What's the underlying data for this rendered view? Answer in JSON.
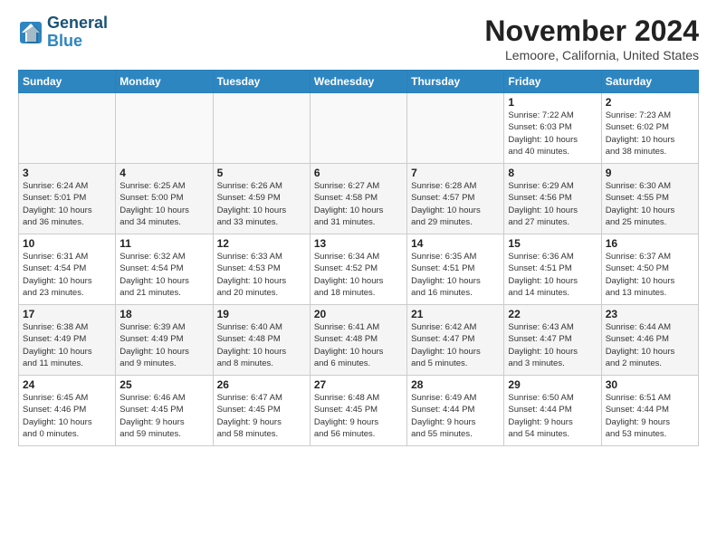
{
  "header": {
    "logo_line1": "General",
    "logo_line2": "Blue",
    "month": "November 2024",
    "location": "Lemoore, California, United States"
  },
  "weekdays": [
    "Sunday",
    "Monday",
    "Tuesday",
    "Wednesday",
    "Thursday",
    "Friday",
    "Saturday"
  ],
  "weeks": [
    [
      {
        "day": "",
        "info": ""
      },
      {
        "day": "",
        "info": ""
      },
      {
        "day": "",
        "info": ""
      },
      {
        "day": "",
        "info": ""
      },
      {
        "day": "",
        "info": ""
      },
      {
        "day": "1",
        "info": "Sunrise: 7:22 AM\nSunset: 6:03 PM\nDaylight: 10 hours\nand 40 minutes."
      },
      {
        "day": "2",
        "info": "Sunrise: 7:23 AM\nSunset: 6:02 PM\nDaylight: 10 hours\nand 38 minutes."
      }
    ],
    [
      {
        "day": "3",
        "info": "Sunrise: 6:24 AM\nSunset: 5:01 PM\nDaylight: 10 hours\nand 36 minutes."
      },
      {
        "day": "4",
        "info": "Sunrise: 6:25 AM\nSunset: 5:00 PM\nDaylight: 10 hours\nand 34 minutes."
      },
      {
        "day": "5",
        "info": "Sunrise: 6:26 AM\nSunset: 4:59 PM\nDaylight: 10 hours\nand 33 minutes."
      },
      {
        "day": "6",
        "info": "Sunrise: 6:27 AM\nSunset: 4:58 PM\nDaylight: 10 hours\nand 31 minutes."
      },
      {
        "day": "7",
        "info": "Sunrise: 6:28 AM\nSunset: 4:57 PM\nDaylight: 10 hours\nand 29 minutes."
      },
      {
        "day": "8",
        "info": "Sunrise: 6:29 AM\nSunset: 4:56 PM\nDaylight: 10 hours\nand 27 minutes."
      },
      {
        "day": "9",
        "info": "Sunrise: 6:30 AM\nSunset: 4:55 PM\nDaylight: 10 hours\nand 25 minutes."
      }
    ],
    [
      {
        "day": "10",
        "info": "Sunrise: 6:31 AM\nSunset: 4:54 PM\nDaylight: 10 hours\nand 23 minutes."
      },
      {
        "day": "11",
        "info": "Sunrise: 6:32 AM\nSunset: 4:54 PM\nDaylight: 10 hours\nand 21 minutes."
      },
      {
        "day": "12",
        "info": "Sunrise: 6:33 AM\nSunset: 4:53 PM\nDaylight: 10 hours\nand 20 minutes."
      },
      {
        "day": "13",
        "info": "Sunrise: 6:34 AM\nSunset: 4:52 PM\nDaylight: 10 hours\nand 18 minutes."
      },
      {
        "day": "14",
        "info": "Sunrise: 6:35 AM\nSunset: 4:51 PM\nDaylight: 10 hours\nand 16 minutes."
      },
      {
        "day": "15",
        "info": "Sunrise: 6:36 AM\nSunset: 4:51 PM\nDaylight: 10 hours\nand 14 minutes."
      },
      {
        "day": "16",
        "info": "Sunrise: 6:37 AM\nSunset: 4:50 PM\nDaylight: 10 hours\nand 13 minutes."
      }
    ],
    [
      {
        "day": "17",
        "info": "Sunrise: 6:38 AM\nSunset: 4:49 PM\nDaylight: 10 hours\nand 11 minutes."
      },
      {
        "day": "18",
        "info": "Sunrise: 6:39 AM\nSunset: 4:49 PM\nDaylight: 10 hours\nand 9 minutes."
      },
      {
        "day": "19",
        "info": "Sunrise: 6:40 AM\nSunset: 4:48 PM\nDaylight: 10 hours\nand 8 minutes."
      },
      {
        "day": "20",
        "info": "Sunrise: 6:41 AM\nSunset: 4:48 PM\nDaylight: 10 hours\nand 6 minutes."
      },
      {
        "day": "21",
        "info": "Sunrise: 6:42 AM\nSunset: 4:47 PM\nDaylight: 10 hours\nand 5 minutes."
      },
      {
        "day": "22",
        "info": "Sunrise: 6:43 AM\nSunset: 4:47 PM\nDaylight: 10 hours\nand 3 minutes."
      },
      {
        "day": "23",
        "info": "Sunrise: 6:44 AM\nSunset: 4:46 PM\nDaylight: 10 hours\nand 2 minutes."
      }
    ],
    [
      {
        "day": "24",
        "info": "Sunrise: 6:45 AM\nSunset: 4:46 PM\nDaylight: 10 hours\nand 0 minutes."
      },
      {
        "day": "25",
        "info": "Sunrise: 6:46 AM\nSunset: 4:45 PM\nDaylight: 9 hours\nand 59 minutes."
      },
      {
        "day": "26",
        "info": "Sunrise: 6:47 AM\nSunset: 4:45 PM\nDaylight: 9 hours\nand 58 minutes."
      },
      {
        "day": "27",
        "info": "Sunrise: 6:48 AM\nSunset: 4:45 PM\nDaylight: 9 hours\nand 56 minutes."
      },
      {
        "day": "28",
        "info": "Sunrise: 6:49 AM\nSunset: 4:44 PM\nDaylight: 9 hours\nand 55 minutes."
      },
      {
        "day": "29",
        "info": "Sunrise: 6:50 AM\nSunset: 4:44 PM\nDaylight: 9 hours\nand 54 minutes."
      },
      {
        "day": "30",
        "info": "Sunrise: 6:51 AM\nSunset: 4:44 PM\nDaylight: 9 hours\nand 53 minutes."
      }
    ]
  ]
}
